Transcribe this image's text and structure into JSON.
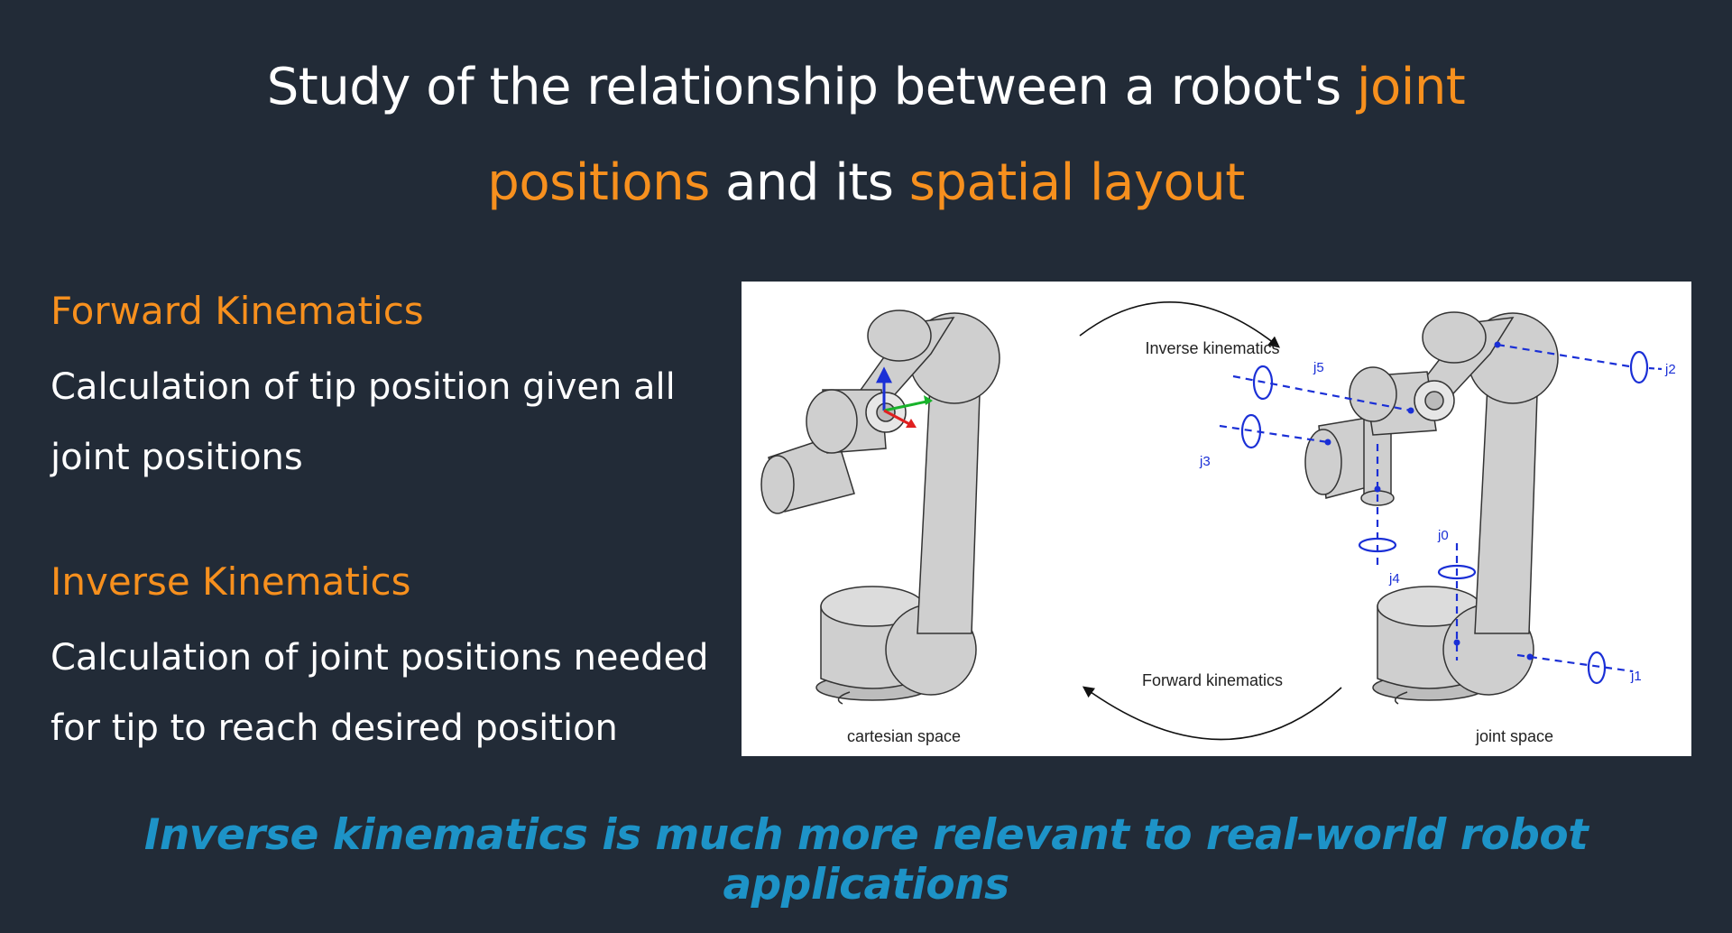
{
  "title": {
    "line1_plain": "Study of the relationship between a robot's ",
    "line1_highlight": "joint",
    "line2_highlight1": "positions",
    "line2_plain": " and its ",
    "line2_highlight2": "spatial layout"
  },
  "forward": {
    "heading": "Forward Kinematics",
    "text": "Calculation of tip position given all joint positions"
  },
  "inverse": {
    "heading": "Inverse Kinematics",
    "text": "Calculation of joint positions needed for tip to reach desired position"
  },
  "diagram": {
    "inverse_label": "Inverse kinematics",
    "forward_label": "Forward kinematics",
    "left_caption": "cartesian space",
    "right_caption": "joint space",
    "joints": [
      "j0",
      "j1",
      "j2",
      "j3",
      "j4",
      "j5"
    ]
  },
  "footer": "Inverse kinematics is much more relevant to real-world robot applications",
  "colors": {
    "background": "#222b37",
    "highlight": "#f7901e",
    "footer": "#1d93c7",
    "joint_blue": "#1a2fd6"
  }
}
